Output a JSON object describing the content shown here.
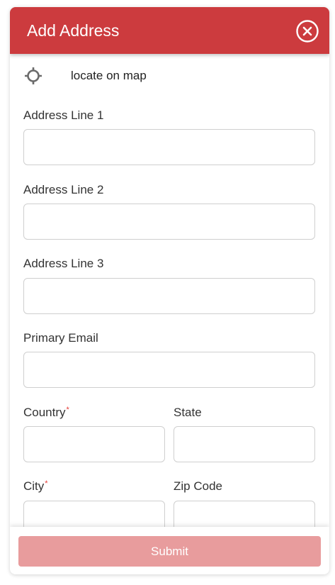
{
  "header": {
    "title": "Add Address",
    "close_icon": "close-circle-icon",
    "background_color": "#cc3b3e"
  },
  "locate": {
    "icon": "crosshair-icon",
    "label": "locate on map"
  },
  "form": {
    "address_line_1": {
      "label": "Address Line 1",
      "value": "",
      "placeholder": ""
    },
    "address_line_2": {
      "label": "Address Line 2",
      "value": "",
      "placeholder": ""
    },
    "address_line_3": {
      "label": "Address Line 3",
      "value": "",
      "placeholder": ""
    },
    "primary_email": {
      "label": "Primary Email",
      "value": "",
      "placeholder": ""
    },
    "country": {
      "label": "Country",
      "required": true,
      "required_mark": "*",
      "value": "",
      "placeholder": ""
    },
    "state": {
      "label": "State",
      "value": "",
      "placeholder": ""
    },
    "city": {
      "label": "City",
      "required": true,
      "required_mark": "*",
      "value": "",
      "placeholder": ""
    },
    "zip_code": {
      "label": "Zip Code",
      "value": "",
      "placeholder": ""
    }
  },
  "footer": {
    "submit_label": "Submit",
    "submit_color": "#e89c9d"
  }
}
